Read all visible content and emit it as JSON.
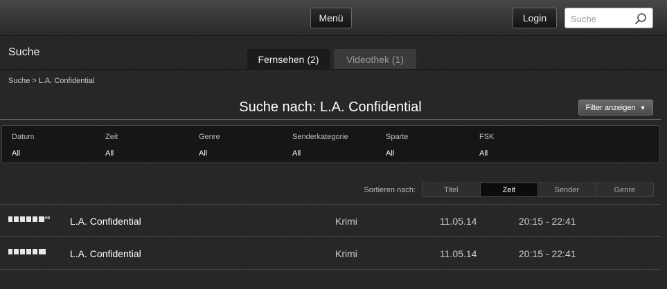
{
  "header": {
    "menu_label": "Menü",
    "login_label": "Login",
    "search_placeholder": "Suche"
  },
  "page_title": "Suche",
  "tabs": [
    {
      "label": "Fernsehen (2)",
      "active": true
    },
    {
      "label": "Videothek (1)",
      "active": false
    }
  ],
  "breadcrumb": "Suche > L.A. Confidential",
  "results_heading": "Suche nach: L.A. Confidential",
  "filter_button": {
    "label": "Filter anzeigen",
    "arrow": "▼"
  },
  "filters": [
    {
      "label": "Datum",
      "value": "All"
    },
    {
      "label": "Zeit",
      "value": "All"
    },
    {
      "label": "Genre",
      "value": "All"
    },
    {
      "label": "Senderkategorie",
      "value": "All"
    },
    {
      "label": "Sparte",
      "value": "All"
    },
    {
      "label": "FSK",
      "value": "All"
    }
  ],
  "sort": {
    "label": "Sortieren nach:",
    "options": [
      "Titel",
      "Zeit",
      "Sender",
      "Genre"
    ],
    "active": "Zeit"
  },
  "results": [
    {
      "channel": "ZMAXX HD",
      "title": "L.A. Confidential",
      "genre": "Krimi",
      "date": "11.05.14",
      "time": "20:15 - 22:41"
    },
    {
      "channel": "ZMAXX",
      "title": "L.A. Confidential",
      "genre": "Krimi",
      "date": "11.05.14",
      "time": "20:15 - 22:41"
    }
  ],
  "colors": {
    "background": "#262626",
    "topbar": "#3a3a3a",
    "active_sort": "#0c0c0c"
  }
}
